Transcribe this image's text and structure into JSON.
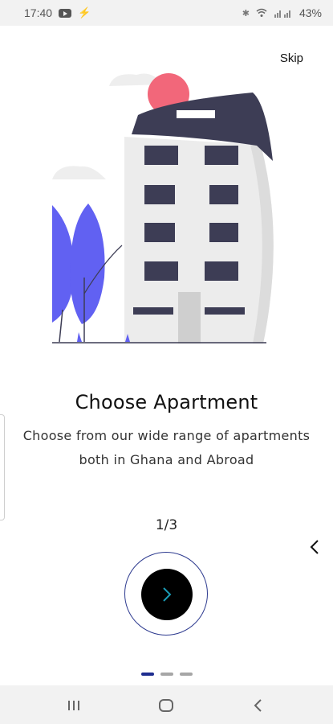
{
  "status_bar": {
    "time": "17:40",
    "battery": "43%",
    "icons": [
      "youtube-icon",
      "charging-bolt-icon",
      "bluetooth-icon",
      "wifi-icon",
      "signal-icon",
      "battery-icon"
    ]
  },
  "skip_label": "Skip",
  "onboarding": {
    "title": "Choose Apartment",
    "description_line1": "Choose from our wide range of apartments",
    "description_line2": "both in Ghana and Abroad",
    "page_indicator": "1/3",
    "current_page": 1,
    "total_pages": 3
  },
  "next_button": {
    "icon": "chevron-right-icon"
  },
  "colors": {
    "accent": "#1e2d8f",
    "building_roof": "#3d3d55",
    "sun": "#f2677a",
    "tree": "#6161f2",
    "button": "#000000",
    "chevron": "#1a9bb5"
  },
  "navigation_bar": {
    "icons": [
      "recent-apps-icon",
      "home-icon",
      "back-icon"
    ]
  }
}
